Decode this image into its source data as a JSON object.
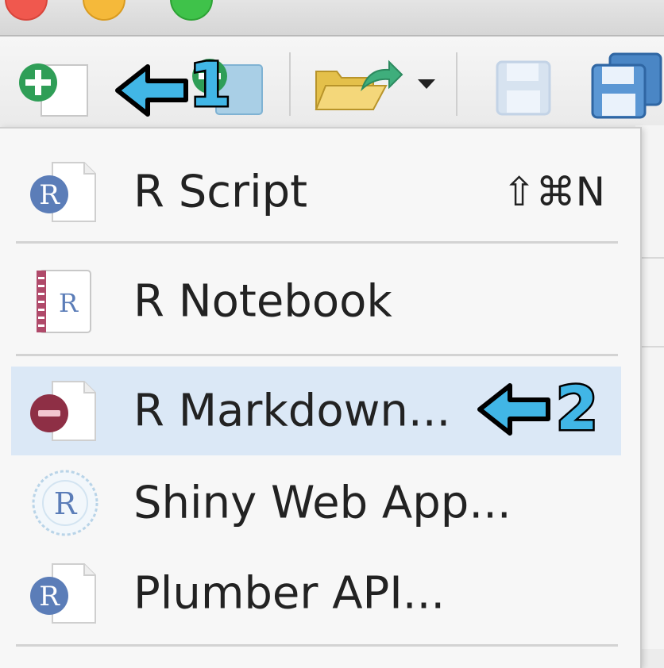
{
  "menu": {
    "items": [
      {
        "label": "R Script",
        "shortcut": "⇧⌘N"
      },
      {
        "label": "R Notebook"
      },
      {
        "label": "R Markdown..."
      },
      {
        "label": "Shiny Web App..."
      },
      {
        "label": "Plumber API..."
      }
    ],
    "highlighted_index": 2
  },
  "callouts": [
    {
      "number": "1"
    },
    {
      "number": "2"
    }
  ],
  "icons": {
    "new_file": "plus-document-icon",
    "open_project": "project-icon",
    "open_folder": "folder-open-icon",
    "save": "save-icon",
    "save_all": "save-all-icon",
    "r_script": "r-document-icon",
    "r_notebook": "r-notebook-icon",
    "r_markdown": "rmd-document-icon",
    "shiny": "shiny-globe-icon",
    "plumber": "r-document-icon"
  },
  "colors": {
    "highlight": "#dbe8f6",
    "callout": "#41b6e6"
  }
}
